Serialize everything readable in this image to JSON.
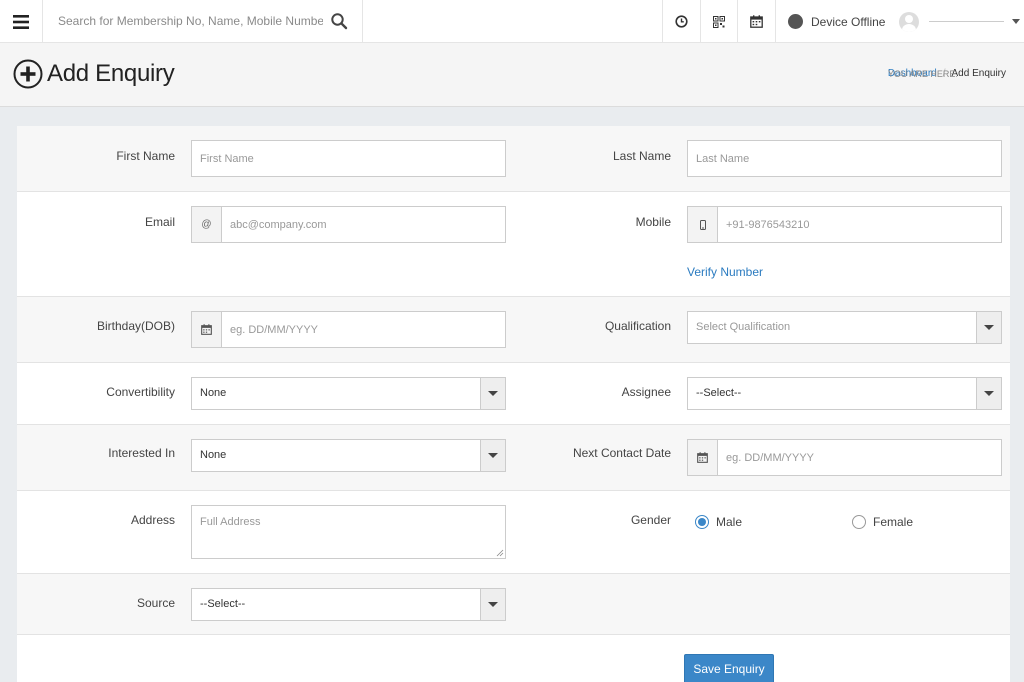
{
  "topbar": {
    "search_placeholder": "Search for Membership No, Name, Mobile Number",
    "device_status": "Device Offline"
  },
  "page": {
    "title": "Add Enquiry",
    "breadcrumb_label": "YOU ARE HERE:",
    "breadcrumb_link": "Dashboard",
    "breadcrumb_sep": "/",
    "breadcrumb_current": "Add Enquiry"
  },
  "form": {
    "first_name_label": "First Name",
    "first_name_placeholder": "First Name",
    "last_name_label": "Last Name",
    "last_name_placeholder": "Last Name",
    "email_label": "Email",
    "email_addon": "@",
    "email_placeholder": "abc@company.com",
    "mobile_label": "Mobile",
    "mobile_placeholder": "+91-9876543210",
    "verify_number": "Verify Number",
    "dob_label": "Birthday(DOB)",
    "dob_placeholder": "eg. DD/MM/YYYY",
    "qualification_label": "Qualification",
    "qualification_value": "Select Qualification",
    "convertibility_label": "Convertibility",
    "convertibility_value": "None",
    "assignee_label": "Assignee",
    "assignee_value": "--Select--",
    "interested_label": "Interested In",
    "interested_value": "None",
    "next_contact_label": "Next Contact Date",
    "next_contact_placeholder": "eg. DD/MM/YYYY",
    "address_label": "Address",
    "address_placeholder": "Full Address",
    "gender_label": "Gender",
    "gender_male": "Male",
    "gender_female": "Female",
    "source_label": "Source",
    "source_value": "--Select--",
    "save_button": "Save Enquiry"
  },
  "colors": {
    "accent": "#3b87c8",
    "link": "#2b7bc0"
  }
}
